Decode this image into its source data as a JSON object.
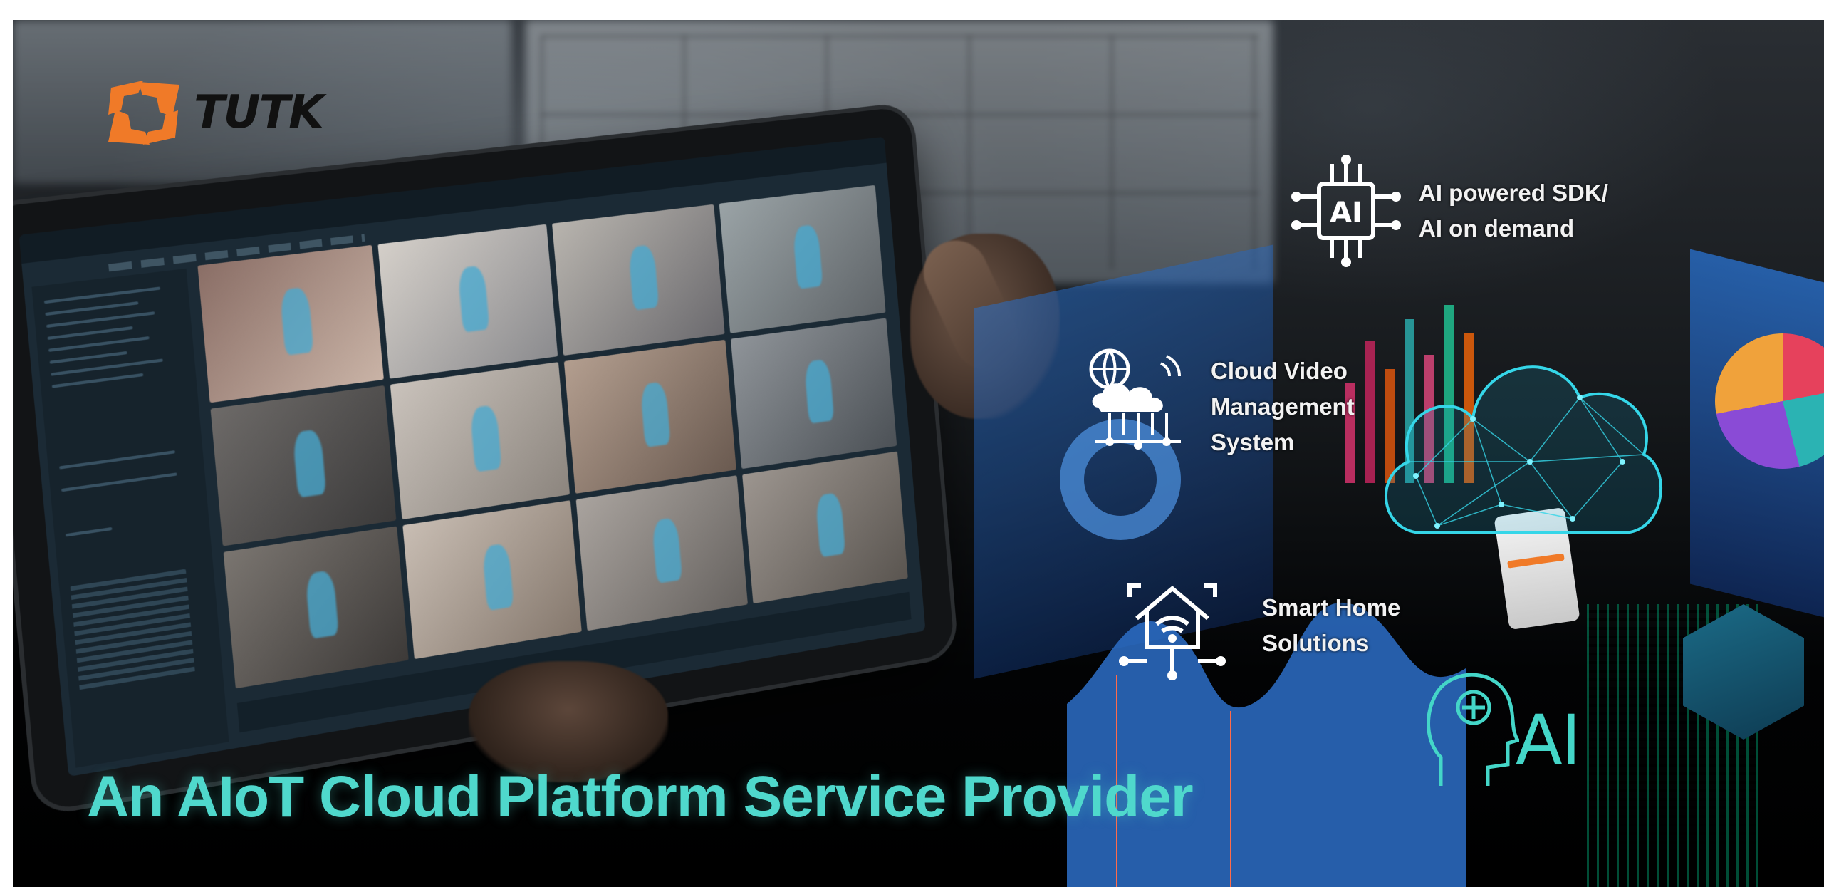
{
  "logo": {
    "text": "TUTK",
    "mark_color": "#f07a28"
  },
  "features": {
    "ai": {
      "icon": "ai-chip-icon",
      "lines": [
        "AI powered SDK/",
        "AI on demand"
      ]
    },
    "cloud": {
      "icon": "cloud-network-icon",
      "lines": [
        "Cloud Video",
        "Management",
        "System"
      ]
    },
    "home": {
      "icon": "smart-home-wifi-icon",
      "lines": [
        "Smart Home",
        "Solutions"
      ]
    }
  },
  "decor": {
    "ai_label": "AI"
  },
  "headline": "An AIoT Cloud Platform Service Provider",
  "colors": {
    "headline": "#4fd8cc",
    "brand_orange": "#f07a28",
    "holo_blue": "#2d6ec8"
  }
}
